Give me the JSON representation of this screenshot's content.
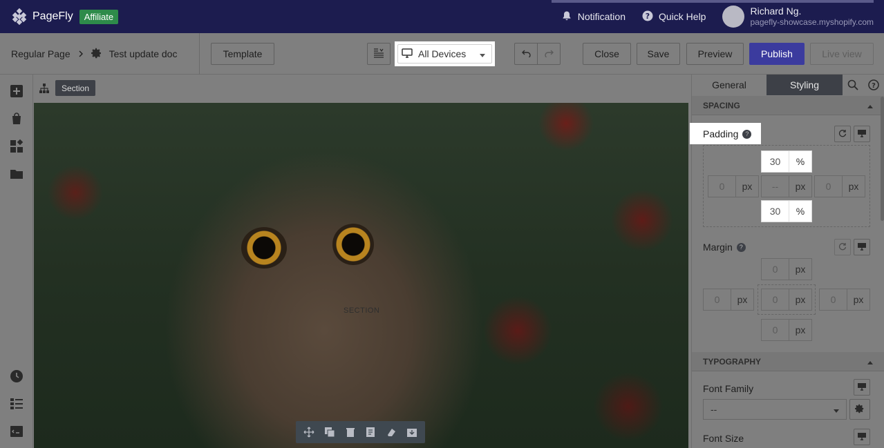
{
  "app": {
    "logo_name": "PageFly",
    "badge": "Affiliate",
    "notification_label": "Notification",
    "quick_help_label": "Quick Help",
    "user_name": "Richard Ng.",
    "user_shop": "pagefly-showcase.myshopify.com"
  },
  "toolbar": {
    "page_type": "Regular Page",
    "page_name": "Test update doc",
    "template_label": "Template",
    "device_label": "All Devices",
    "close_label": "Close",
    "save_label": "Save",
    "preview_label": "Preview",
    "publish_label": "Publish",
    "live_view_label": "Live view"
  },
  "canvas": {
    "chip_label": "Section",
    "section_label": "SECTION"
  },
  "panel": {
    "tabs": [
      {
        "label": "General"
      },
      {
        "label": "Styling"
      }
    ],
    "spacing": {
      "heading": "SPACING",
      "padding_label": "Padding",
      "padding": {
        "top": {
          "value": "30",
          "unit": "%"
        },
        "left": {
          "value": "0",
          "unit": "px"
        },
        "center": {
          "value": "--",
          "unit": "px"
        },
        "right": {
          "value": "0",
          "unit": "px"
        },
        "bottom": {
          "value": "30",
          "unit": "%"
        }
      },
      "margin_label": "Margin",
      "margin": {
        "top": {
          "value": "0",
          "unit": "px"
        },
        "left": {
          "value": "0",
          "unit": "px"
        },
        "center": {
          "value": "0",
          "unit": "px"
        },
        "right": {
          "value": "0",
          "unit": "px"
        },
        "bottom": {
          "value": "0",
          "unit": "px"
        }
      }
    },
    "typography": {
      "heading": "TYPOGRAPHY",
      "font_family_label": "Font Family",
      "font_family_value": "--",
      "font_size_label": "Font Size"
    }
  },
  "colors": {
    "topbar": "#1c1c4f",
    "publish": "#3b3b9e",
    "affiliate": "#2e8b4a"
  }
}
